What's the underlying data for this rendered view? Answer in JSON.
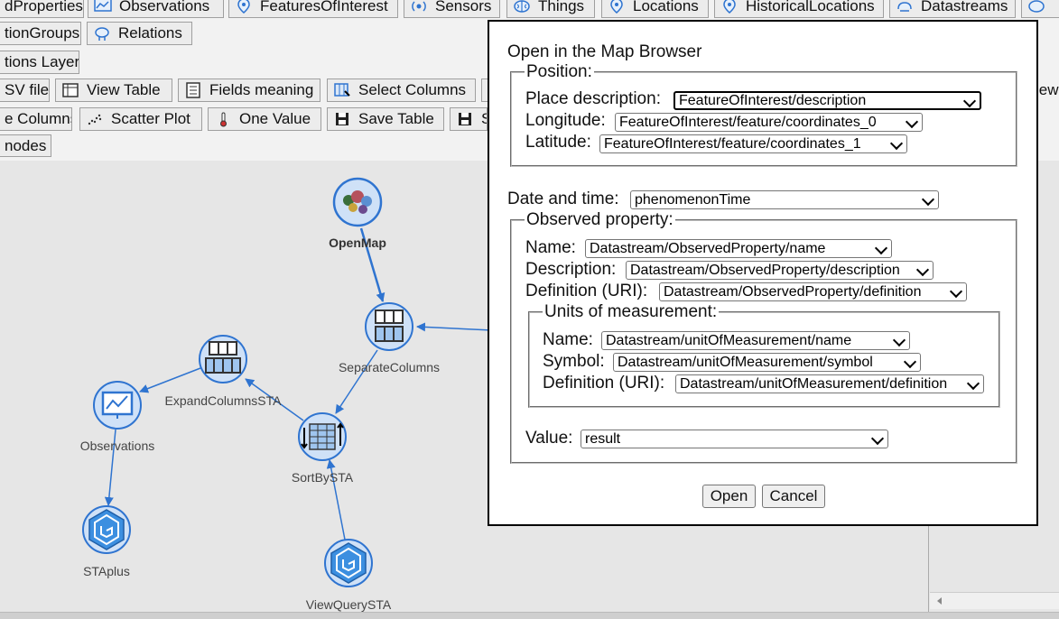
{
  "tabs": [
    {
      "label": "dProperties"
    },
    {
      "label": "Observations"
    },
    {
      "label": "FeaturesOfInterest"
    },
    {
      "label": "Sensors"
    },
    {
      "label": "Things"
    },
    {
      "label": "Locations"
    },
    {
      "label": "HistoricalLocations"
    },
    {
      "label": "Datastreams"
    }
  ],
  "tabs_row2": [
    {
      "label": "tionGroups"
    },
    {
      "label": "Relations"
    }
  ],
  "layer_label": "tions Layer",
  "toolbar_row1": [
    {
      "label": "SV file"
    },
    {
      "label": "View Table"
    },
    {
      "label": "Fields meaning"
    },
    {
      "label": "Select Columns"
    },
    {
      "label": "iew"
    }
  ],
  "toolbar_row2": [
    {
      "label": "e Columns"
    },
    {
      "label": "Scatter Plot"
    },
    {
      "label": "One Value"
    },
    {
      "label": "Save Table"
    },
    {
      "label": "S"
    }
  ],
  "nodes_button": "nodes",
  "graph_nodes": [
    {
      "label": "OpenMap"
    },
    {
      "label": "SeparateColumns"
    },
    {
      "label": "ExpandColumnsSTA"
    },
    {
      "label": "Observations"
    },
    {
      "label": "SortBySTA"
    },
    {
      "label": "STAplus"
    },
    {
      "label": "ViewQuerySTA"
    }
  ],
  "dialog": {
    "title": "Open in the Map Browser",
    "position_legend": "Position:",
    "place_description_label": "Place description:",
    "place_description_value": "FeatureOfInterest/description",
    "longitude_label": "Longitude:",
    "longitude_value": "FeatureOfInterest/feature/coordinates_0",
    "latitude_label": "Latitude:",
    "latitude_value": "FeatureOfInterest/feature/coordinates_1",
    "date_time_label": "Date and time:",
    "date_time_value": "phenomenonTime",
    "observed_property_legend": "Observed property:",
    "op_name_label": "Name:",
    "op_name_value": "Datastream/ObservedProperty/name",
    "op_description_label": "Description:",
    "op_description_value": "Datastream/ObservedProperty/description",
    "op_definition_label": "Definition (URI):",
    "op_definition_value": "Datastream/ObservedProperty/definition",
    "units_legend": "Units of measurement:",
    "unit_name_label": "Name:",
    "unit_name_value": "Datastream/unitOfMeasurement/name",
    "unit_symbol_label": "Symbol:",
    "unit_symbol_value": "Datastream/unitOfMeasurement/symbol",
    "unit_definition_label": "Definition (URI):",
    "unit_definition_value": "Datastream/unitOfMeasurement/definition",
    "value_label": "Value:",
    "value_value": "result",
    "open_button": "Open",
    "cancel_button": "Cancel"
  },
  "colors": {
    "node_fill": "#cfe1f7",
    "node_border": "#2f74d0",
    "edge": "#2f74d0",
    "dialog_border": "#000000"
  }
}
